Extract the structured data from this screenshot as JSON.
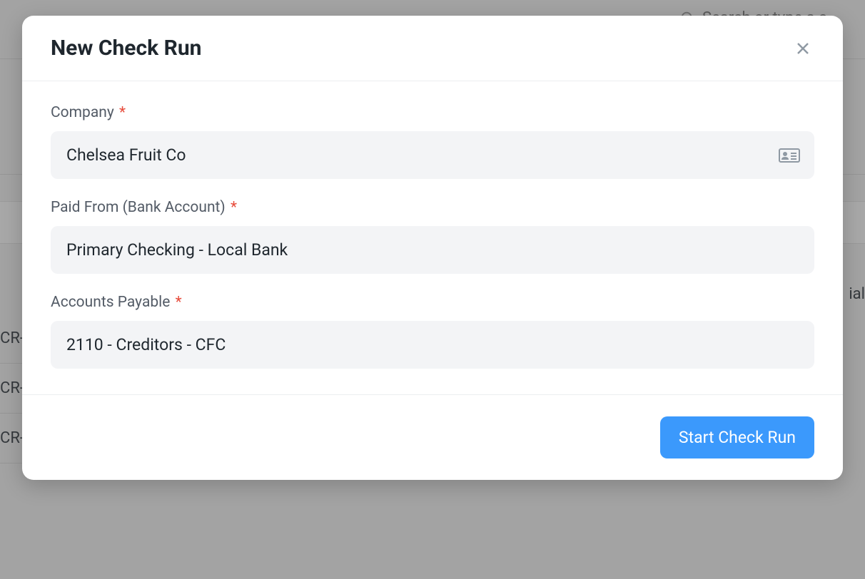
{
  "background": {
    "search_placeholder": "Search or type a c",
    "row_prefixes": [
      "CR-",
      "CR-",
      "CR-"
    ],
    "right_fragment": "ial"
  },
  "modal": {
    "title": "New Check Run",
    "fields": {
      "company": {
        "label": "Company",
        "value": "Chelsea Fruit Co"
      },
      "paid_from": {
        "label": "Paid From (Bank Account)",
        "value": "Primary Checking - Local Bank"
      },
      "accounts_payable": {
        "label": "Accounts Payable",
        "value": "2110 - Creditors - CFC"
      }
    },
    "submit_label": "Start Check Run"
  }
}
